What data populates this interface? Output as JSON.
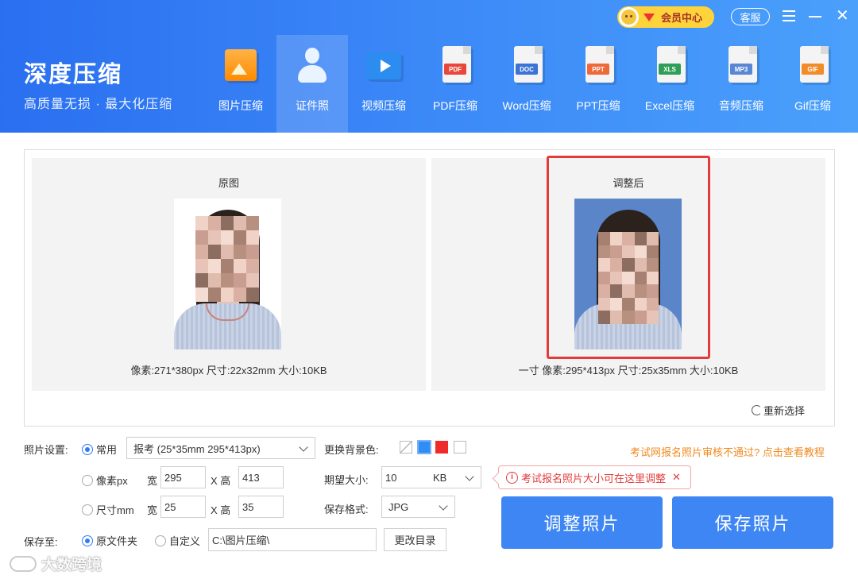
{
  "app": {
    "title": "深度压缩",
    "subtitle": "高质量无损 · 最大化压缩",
    "vip_label": "会员中心",
    "kefu_label": "客服"
  },
  "nav": {
    "items": [
      {
        "label": "图片压缩",
        "icon": "image-icon"
      },
      {
        "label": "证件照",
        "icon": "id-photo-icon"
      },
      {
        "label": "视频压缩",
        "icon": "video-icon"
      },
      {
        "label": "PDF压缩",
        "icon": "pdf-icon",
        "tag": "PDF",
        "color": "#e8483b"
      },
      {
        "label": "Word压缩",
        "icon": "word-icon",
        "tag": "DOC",
        "color": "#3b73d6"
      },
      {
        "label": "PPT压缩",
        "icon": "ppt-icon",
        "tag": "PPT",
        "color": "#ef6a3a"
      },
      {
        "label": "Excel压缩",
        "icon": "excel-icon",
        "tag": "XLS",
        "color": "#2f9e57"
      },
      {
        "label": "音频压缩",
        "icon": "audio-icon",
        "tag": "MP3",
        "color": "#5a86d6"
      },
      {
        "label": "Gif压缩",
        "icon": "gif-icon",
        "tag": "GIF",
        "color": "#f28c28"
      }
    ],
    "active": "证件照"
  },
  "preview": {
    "original": {
      "title": "原图",
      "caption": "像素:271*380px  尺寸:22x32mm  大小:10KB",
      "background_color": "#ffffff"
    },
    "adjusted": {
      "title": "调整后",
      "caption": "一寸  像素:295*413px  尺寸:25x35mm  大小:10KB",
      "background_color": "#5a85c9"
    },
    "reselect_label": "重新选择"
  },
  "settings": {
    "photo_setting_label": "照片设置:",
    "mode_common_label": "常用",
    "mode_pixel_label": "像素px",
    "mode_mm_label": "尺寸mm",
    "preset_value": "报考 (25*35mm 295*413px)",
    "width_label": "宽",
    "height_label": "X 高",
    "px_width": "295",
    "px_height": "413",
    "mm_width": "25",
    "mm_height": "35",
    "bg_color_label": "更换背景色:",
    "bg_colors": [
      "none",
      "#2e8ef5",
      "#ee2a2a",
      "#ffffff"
    ],
    "bg_selected": "#2e8ef5",
    "expected_size_label": "期望大小:",
    "expected_size_value": "10",
    "expected_size_unit": "KB",
    "format_label": "保存格式:",
    "format_value": "JPG",
    "save_to_label": "保存至:",
    "save_original_label": "原文件夹",
    "save_custom_label": "自定义",
    "save_path": "C:\\图片压缩\\",
    "change_dir_label": "更改目录",
    "tip_link": "考试网报名照片审核不通过? 点击查看教程",
    "tip_popup": "考试报名照片大小可在这里调整",
    "adjust_button": "调整照片",
    "save_button": "保存照片"
  },
  "watermark": "大数跨境"
}
